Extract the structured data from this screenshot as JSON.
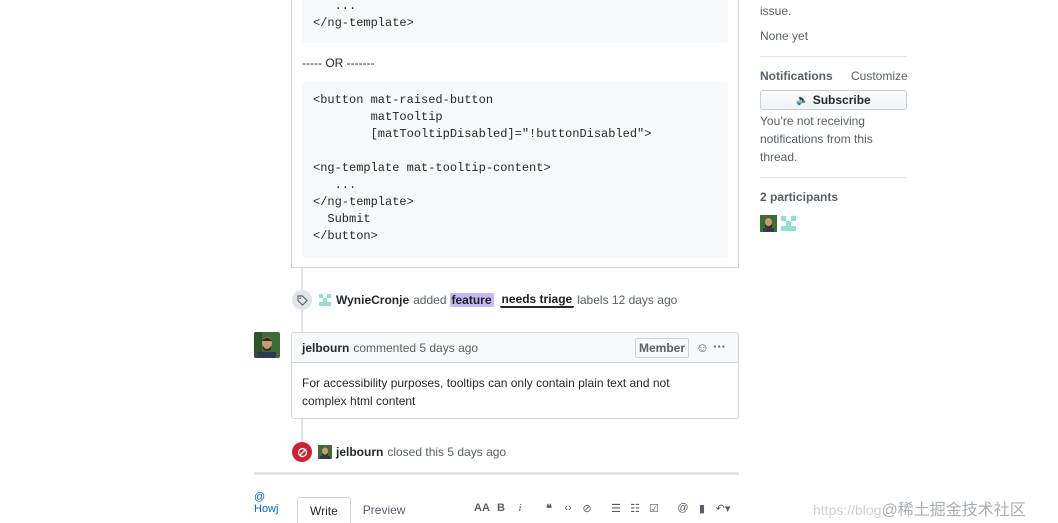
{
  "code_top": "   ...\n</ng-template>",
  "or_separator": "----- OR -------",
  "code_main": "<button mat-raised-button\n        matTooltip\n        [matTooltipDisabled]=\"!buttonDisabled\">\n\n<ng-template mat-tooltip-content>\n   ...\n</ng-template>\n  Submit\n</button>",
  "label_event": {
    "author": "WynieCronje",
    "action": "added",
    "labels": [
      "feature",
      "needs triage"
    ],
    "suffix": "labels 12 days ago"
  },
  "comment": {
    "author": "jelbourn",
    "meta": "commented 5 days ago",
    "badge": "Member",
    "body": "For accessibility purposes, tooltips can only contain plain text and not complex html content"
  },
  "closed_event": {
    "author": "jelbourn",
    "text": "closed this 5 days ago"
  },
  "editor": {
    "broken_image_alt": "@\nHowj",
    "tabs": [
      "Write",
      "Preview"
    ]
  },
  "sidebar": {
    "top_text": "issue.",
    "none_yet": "None yet",
    "notifications_heading": "Notifications",
    "customize": "Customize",
    "subscribe_label": "Subscribe",
    "notif_text": "You’re not receiving notifications from this thread.",
    "participants_heading": "2 participants"
  },
  "watermark": {
    "url": "https://blog",
    "text": "@稀土掘金技术社区"
  },
  "colors": {
    "feature_label": "#c5b7f0",
    "closed_red": "#cb2431"
  }
}
